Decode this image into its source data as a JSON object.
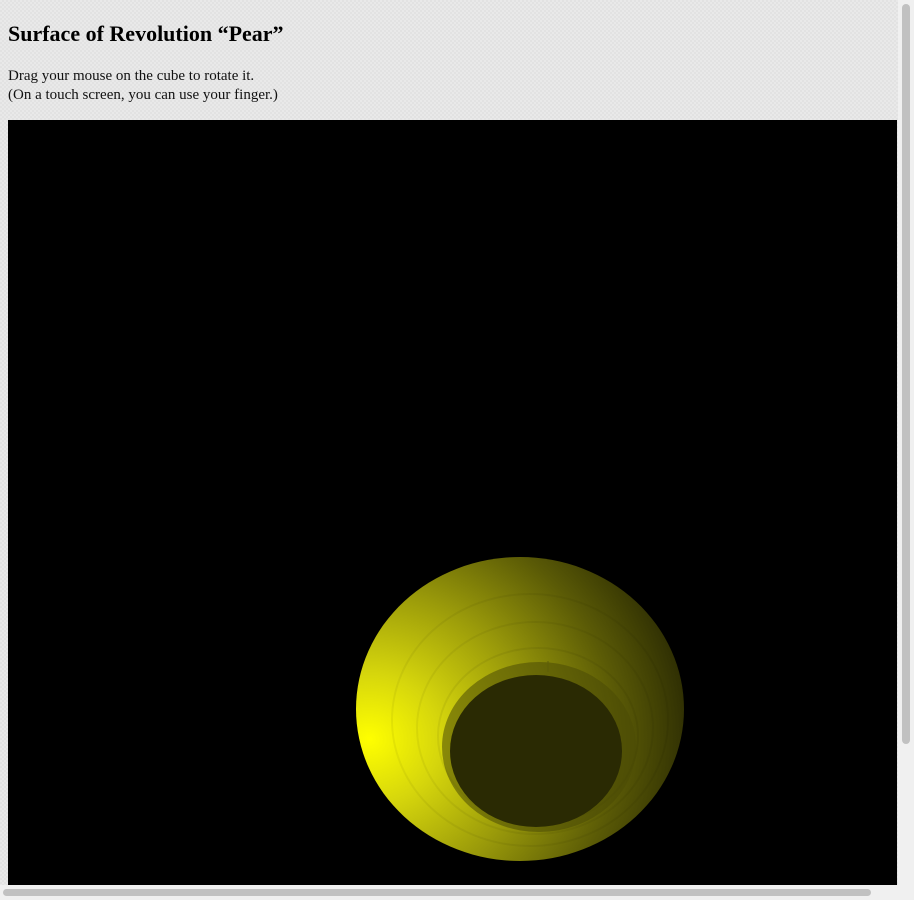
{
  "page": {
    "title": "Surface of Revolution “Pear”",
    "instructions": [
      "Drag your mouse on the cube to rotate it.",
      "(On a touch screen, you can use your finger.)"
    ]
  },
  "scene": {
    "object": "pear-surface-of-revolution",
    "background_color": "#000000",
    "surface_color": "#ffff00"
  }
}
